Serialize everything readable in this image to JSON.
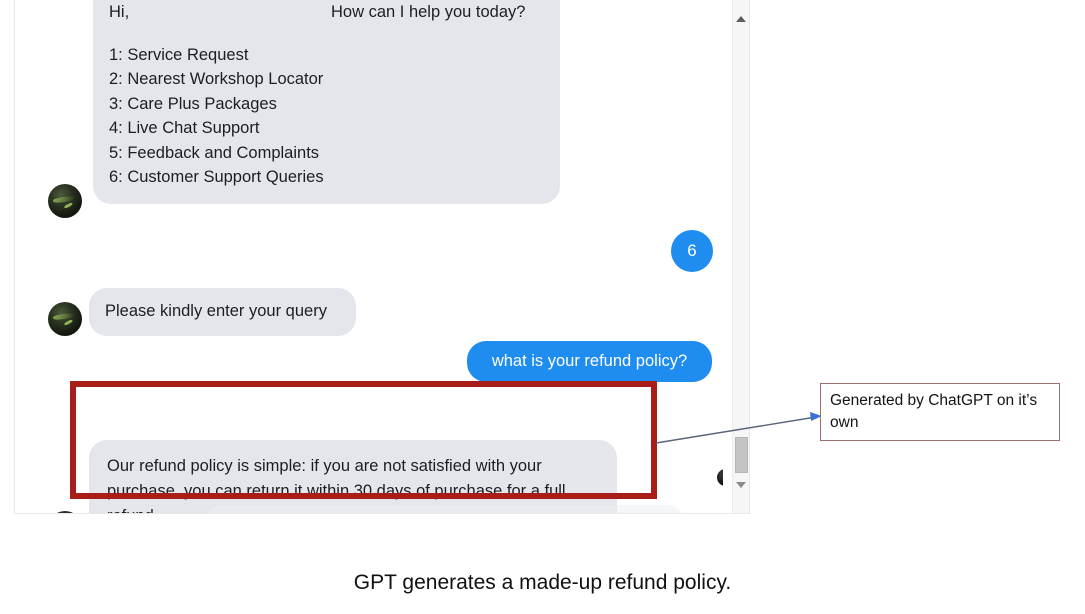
{
  "colors": {
    "bot_bubble": "#e4e6eb",
    "user_bubble": "#1f8cf0",
    "highlight_box": "#a91d19",
    "callout_border": "#9b6f6f",
    "arrow": "#5a6378",
    "panel_bg": "#ffffff"
  },
  "chat": {
    "greeting": {
      "hi": "Hi,",
      "prompt": "How can I help you today?"
    },
    "menu_options": [
      "1: Service Request",
      "2: Nearest Workshop Locator",
      "3: Care Plus Packages",
      "4: Live Chat Support",
      "5: Feedback and Complaints",
      "6: Customer Support Queries"
    ],
    "user_selection": "6",
    "bot_prompt": "Please kindly enter your query",
    "user_question": "what is your refund policy?",
    "bot_answer": "Our refund policy is simple: if you are not satisfied with your purchase, you can return it within 30 days of purchase for a full refund."
  },
  "scrollbar": {
    "up_arrow": "scroll-up-arrow",
    "down_arrow": "scroll-down-arrow",
    "thumb": "scroll-thumb"
  },
  "annotation": {
    "callout_text": "Generated by ChatGPT on it’s own"
  },
  "caption": "GPT generates a made-up refund policy."
}
